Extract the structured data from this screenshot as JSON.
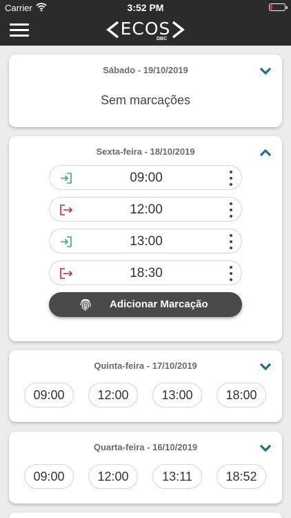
{
  "status_bar": {
    "carrier": "Carrier",
    "time": "3:52 PM"
  },
  "header": {
    "logo_text": "ECOS",
    "logo_sub": "DBC"
  },
  "days": [
    {
      "date": "Sábado - 19/10/2019",
      "empty_text": "Sem marcações",
      "expanded": false
    },
    {
      "date": "Sexta-feira - 18/10/2019",
      "expanded": true,
      "entries": [
        {
          "time": "09:00",
          "type": "entrada",
          "icon": "login-icon",
          "color": "#3aa876"
        },
        {
          "time": "12:00",
          "type": "saida",
          "icon": "logout-icon",
          "color": "#c62828"
        },
        {
          "time": "13:00",
          "type": "entrada",
          "icon": "login-icon",
          "color": "#3aa876"
        },
        {
          "time": "18:30",
          "type": "saida",
          "icon": "logout-icon",
          "color": "#c62828"
        }
      ],
      "add_button_label": "Adicionar Marcação"
    },
    {
      "date": "Quinta-feira - 17/10/2019",
      "expanded": false,
      "times": [
        "09:00",
        "12:00",
        "13:00",
        "18:00"
      ]
    },
    {
      "date": "Quarta-feira - 16/10/2019",
      "expanded": false,
      "times": [
        "09:00",
        "12:00",
        "13:11",
        "18:52"
      ]
    }
  ],
  "colors": {
    "header_bg": "#2b2b2b",
    "chevron": "#1f6e8c",
    "entry": "#3aa876",
    "exit": "#c62828"
  }
}
